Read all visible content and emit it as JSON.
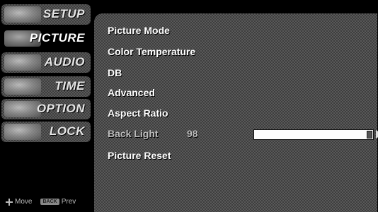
{
  "sidebar": {
    "items": [
      {
        "label": "SETUP",
        "icon": "setup-icon",
        "active": false
      },
      {
        "label": "PICTURE",
        "icon": "picture-icon",
        "active": true
      },
      {
        "label": "AUDIO",
        "icon": "audio-icon",
        "active": false
      },
      {
        "label": "TIME",
        "icon": "time-icon",
        "active": false
      },
      {
        "label": "OPTION",
        "icon": "option-icon",
        "active": false
      },
      {
        "label": "LOCK",
        "icon": "lock-icon",
        "active": false
      }
    ],
    "hint": {
      "move_label": "Move",
      "back_key_label": "BACK",
      "prev_label": "Prev"
    }
  },
  "menu": {
    "items": [
      {
        "label": "Picture Mode"
      },
      {
        "label": "Color Temperature"
      },
      {
        "label": "DB"
      },
      {
        "label": "Advanced"
      },
      {
        "label": "Aspect Ratio"
      },
      {
        "label": "Back Light",
        "value": "98",
        "level": 0.98
      },
      {
        "label": "Picture Reset"
      }
    ]
  }
}
